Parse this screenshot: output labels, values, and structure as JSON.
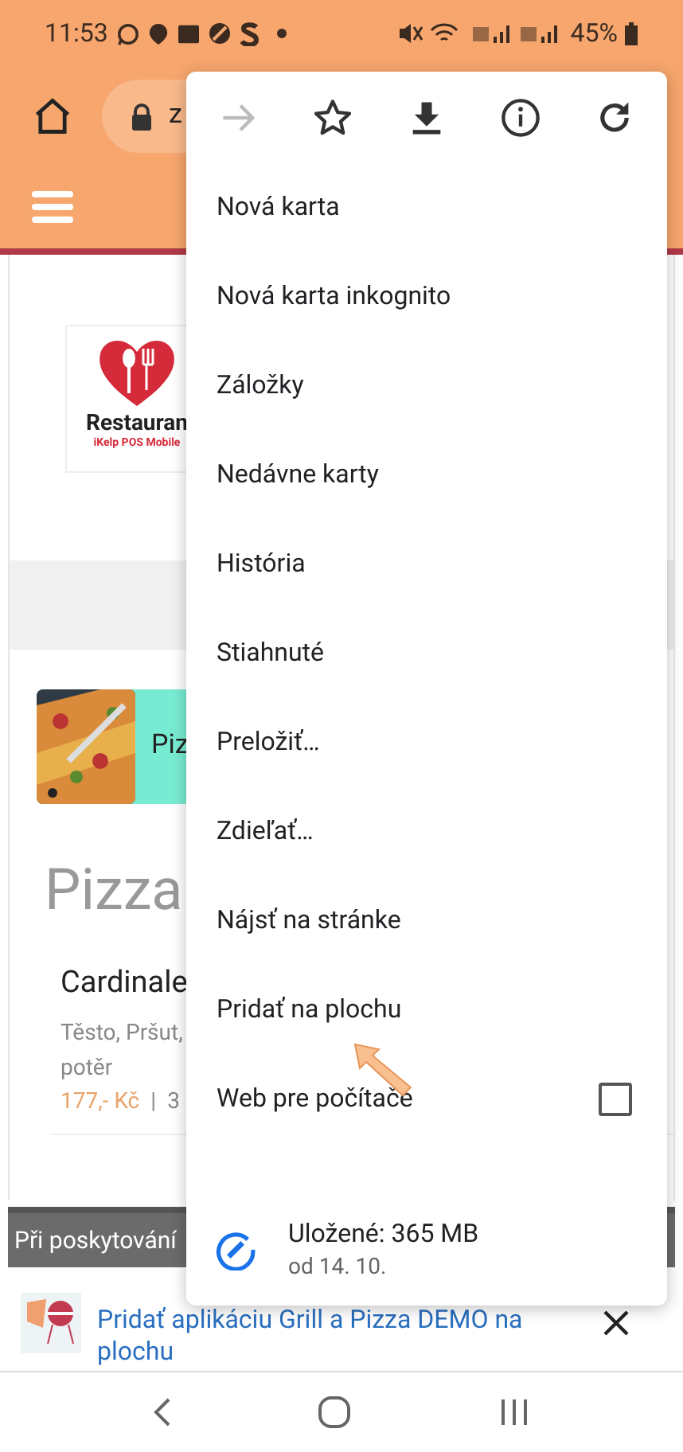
{
  "status_bar": {
    "time": "11:53",
    "battery": "45%"
  },
  "browser_toolbar": {
    "url": "z"
  },
  "page": {
    "logo_title": "Restauran",
    "logo_subtitle": "iKelp POS Mobile",
    "category": "Piz",
    "heading": "Pizza",
    "item": {
      "name": "Cardinale",
      "description_lines": [
        "Těsto, Pršut,",
        "potěr"
      ],
      "price": "177,- Kč",
      "separator": "|",
      "column_3": "3"
    }
  },
  "cookie_banner": "Při poskytování",
  "menu": {
    "actions": [
      {
        "kind": "forward",
        "disabled": true
      },
      {
        "kind": "bookmark",
        "disabled": false
      },
      {
        "kind": "download",
        "disabled": false
      },
      {
        "kind": "info",
        "disabled": false
      },
      {
        "kind": "reload",
        "disabled": false
      }
    ],
    "items": [
      {
        "label": "Nová karta",
        "kind": "plain"
      },
      {
        "label": "Nová karta inkognito",
        "kind": "plain"
      },
      {
        "label": "Záložky",
        "kind": "plain"
      },
      {
        "label": "Nedávne karty",
        "kind": "plain"
      },
      {
        "label": "História",
        "kind": "plain"
      },
      {
        "label": "Stiahnuté",
        "kind": "plain"
      },
      {
        "label": "Preložiť…",
        "kind": "plain"
      },
      {
        "label": "Zdieľať…",
        "kind": "plain"
      },
      {
        "label": "Nájsť na stránke",
        "kind": "plain"
      },
      {
        "label": "Pridať na plochu",
        "kind": "plain"
      },
      {
        "label": "Web pre počítače",
        "kind": "checkbox",
        "checked": false
      }
    ],
    "savings": {
      "title": "Uložené: 365 MB",
      "subtitle": "od 14. 10."
    }
  },
  "install_prompt": {
    "text": "Pridať aplikáciu Grill a Pizza DEMO na plochu"
  }
}
